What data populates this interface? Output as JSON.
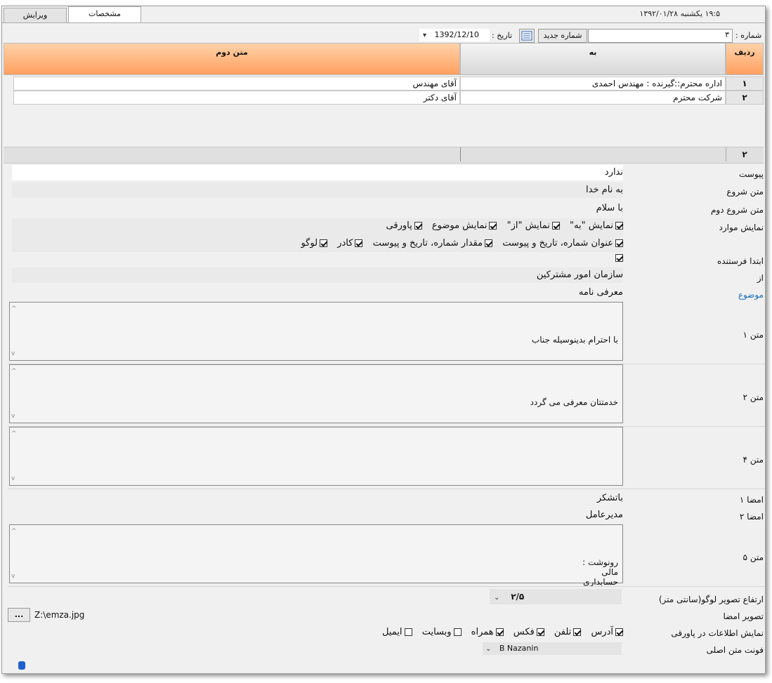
{
  "tabs": [
    {
      "label": "ویرایش"
    },
    {
      "label": "مشخصات"
    }
  ],
  "datebar": "۱۹:۵ یکشنبه ۱۳۹۲/۰۱/۲۸",
  "top": {
    "number_label": "شماره :",
    "number_value": "۳",
    "new_number_button": "شماره جدید",
    "date_label": "تاریخ :",
    "date_value": "1392/12/10"
  },
  "grid": {
    "headers": {
      "radif": "ردیف",
      "be": "به",
      "matn_dovom": "متن دوم"
    },
    "rows": [
      {
        "idx": "۱",
        "be": "اداره محترم::گیرنده : مهندس احمدی",
        "second": "آقای مهندس"
      },
      {
        "idx": "۲",
        "be": "شرکت محترم",
        "second": "آقای دکتر"
      }
    ],
    "nav_index": "۲"
  },
  "form": {
    "labels": {
      "peyvast": "پیوست",
      "matn_shoru": "متن شروع",
      "matn_shoru_dovom": "متن شروع دوم",
      "namayesh_mavared": "نمایش موارد",
      "ebteda_ferestande": "ابتدا فرستنده",
      "az": "از",
      "mozu": "موضوع",
      "matn1": "متن ۱",
      "matn2": "متن ۲",
      "matn4": "متن ۴",
      "emza1": "امضا ۱",
      "emza2": "امضا ۲",
      "matn5": "متن ۵",
      "logo_height": "ارتفاع تصویر لوگو(سانتی متر)",
      "emza_image": "تصویر امضا",
      "footer_info": "نمایش اطلاعات در پاورقی",
      "main_font": "فونت متن اصلی"
    },
    "values": {
      "peyvast": "ندارد",
      "matn_shoru": "به نام خدا",
      "matn_shoru_dovom": "با سلام",
      "az": "سازمان امور مشترکین",
      "mozu": "معرفی نامه",
      "matn1": "با احترام بدینوسیله جناب",
      "matn2": "خدمتتان معرفی می گردد",
      "matn4": "",
      "emza1": "باتشکر",
      "emza2": "مدیرعامل",
      "matn5": "رونوشت :\nمالی\nحسابداری",
      "logo_height": "۲/۵",
      "emza_path": "Z:\\emza.jpg",
      "browse_button": "...",
      "main_font": "B Nazanin"
    },
    "show_items_row1": [
      {
        "label": "نمایش \"به\"",
        "checked": true
      },
      {
        "label": "نمایش \"از\"",
        "checked": true
      },
      {
        "label": "نمایش موضوع",
        "checked": true
      },
      {
        "label": "پاورقی",
        "checked": true
      }
    ],
    "show_items_row2": [
      {
        "label": "عنوان شماره، تاریخ و پیوست",
        "checked": true
      },
      {
        "label": "مقدار شماره، تاریخ و پیوست",
        "checked": true
      },
      {
        "label": "کادر",
        "checked": true
      },
      {
        "label": "لوگو",
        "checked": true
      }
    ],
    "sender_first_checked": true,
    "footer_items": [
      {
        "label": "آدرس",
        "checked": true
      },
      {
        "label": "تلفن",
        "checked": true
      },
      {
        "label": "فکس",
        "checked": true
      },
      {
        "label": "همراه",
        "checked": true
      },
      {
        "label": "وبسایت",
        "checked": false
      },
      {
        "label": "ایمیل",
        "checked": false
      }
    ]
  }
}
